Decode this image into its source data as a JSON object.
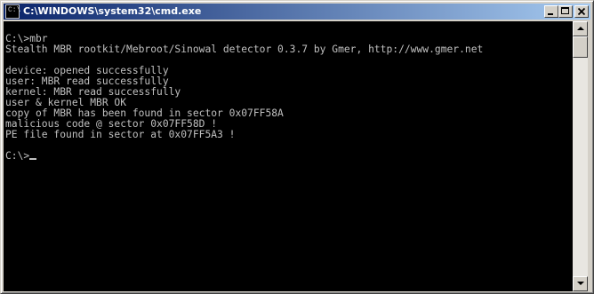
{
  "window": {
    "title": "C:\\WINDOWS\\system32\\cmd.exe",
    "icon": "console-icon",
    "icon_text": "C:\\",
    "buttons": {
      "minimize": "minimize-icon",
      "maximize": "maximize-icon",
      "close": "close-icon"
    }
  },
  "console": {
    "lines": [
      "C:\\>mbr",
      "Stealth MBR rootkit/Mebroot/Sinowal detector 0.3.7 by Gmer, http://www.gmer.net",
      "",
      "device: opened successfully",
      "user: MBR read successfully",
      "kernel: MBR read successfully",
      "user & kernel MBR OK",
      "copy of MBR has been found in sector 0x07FF58A",
      "malicious code @ sector 0x07FF58D !",
      "PE file found in sector at 0x07FF5A3 !",
      "",
      "C:\\>"
    ],
    "text_color": "#c0c0c0",
    "background": "#000000"
  },
  "scrollbar": {
    "up": "scroll-up-arrow-icon",
    "down": "scroll-down-arrow-icon",
    "position": 0
  },
  "colors": {
    "titlebar_start": "#0a246a",
    "titlebar_end": "#a6caf0",
    "chrome": "#d4d0c8"
  }
}
